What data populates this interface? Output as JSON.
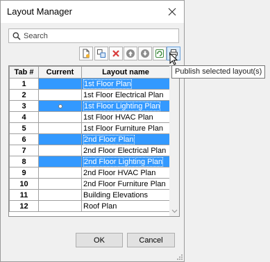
{
  "window": {
    "title": "Layout Manager"
  },
  "search": {
    "placeholder": "Search",
    "value": ""
  },
  "toolbar": {
    "tooltip": "Publish selected layout(s)",
    "buttons": [
      {
        "icon": "new-layout-icon"
      },
      {
        "icon": "copy-layout-icon"
      },
      {
        "icon": "delete-icon"
      },
      {
        "icon": "move-up-icon"
      },
      {
        "icon": "move-down-icon"
      },
      {
        "icon": "refresh-icon"
      },
      {
        "icon": "publish-printer-icon"
      }
    ]
  },
  "table": {
    "headers": {
      "tab": "Tab #",
      "current": "Current",
      "name": "Layout name"
    },
    "rows": [
      {
        "tab": "1",
        "name": "1st Floor Plan",
        "selected": true,
        "current": false
      },
      {
        "tab": "2",
        "name": "1st Floor Electrical Plan",
        "selected": false,
        "current": false
      },
      {
        "tab": "3",
        "name": "1st Floor Lighting Plan",
        "selected": true,
        "current": true
      },
      {
        "tab": "4",
        "name": "1st Floor HVAC Plan",
        "selected": false,
        "current": false
      },
      {
        "tab": "5",
        "name": "1st Floor Furniture Plan",
        "selected": false,
        "current": false
      },
      {
        "tab": "6",
        "name": "2nd Floor Plan",
        "selected": true,
        "current": false
      },
      {
        "tab": "7",
        "name": "2nd Floor Electrical Plan",
        "selected": false,
        "current": false
      },
      {
        "tab": "8",
        "name": "2nd Floor Lighting Plan",
        "selected": true,
        "current": false
      },
      {
        "tab": "9",
        "name": "2nd Floor HVAC Plan",
        "selected": false,
        "current": false
      },
      {
        "tab": "10",
        "name": "2nd Floor Furniture Plan",
        "selected": false,
        "current": false
      },
      {
        "tab": "11",
        "name": "Building Elevations",
        "selected": false,
        "current": false
      },
      {
        "tab": "12",
        "name": "Roof Plan",
        "selected": false,
        "current": false
      }
    ]
  },
  "buttons": {
    "ok": "OK",
    "cancel": "Cancel"
  },
  "colors": {
    "selection": "#3399ff",
    "dialog_bg": "#f0f0f0",
    "delete_red": "#d83b3b"
  }
}
